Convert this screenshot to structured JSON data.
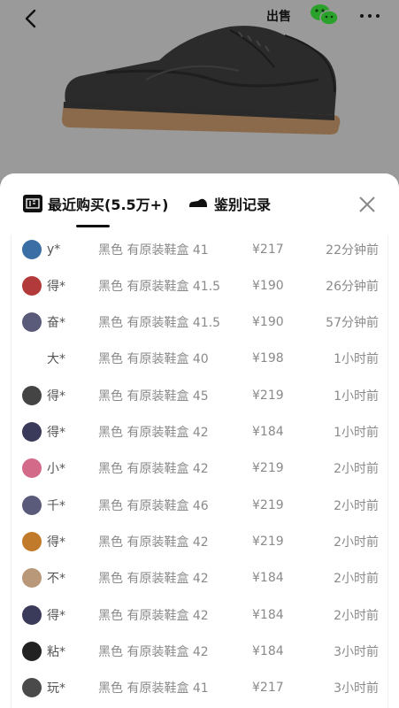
{
  "header": {
    "sell_label": "出售"
  },
  "tabs": {
    "recent": "最近购买(5.5万+)",
    "appraisal": "鉴别记录"
  },
  "colors": {
    "accent": "#111111",
    "wechat": "#2aa12a"
  },
  "records": [
    {
      "user": "y*",
      "desc": "黑色 有原装鞋盒 41",
      "price": "¥217",
      "time": "22分钟前",
      "avatar": "#3a6ea5"
    },
    {
      "user": "得*",
      "desc": "黑色 有原装鞋盒 41.5",
      "price": "¥190",
      "time": "26分钟前",
      "avatar": "#b33a3a"
    },
    {
      "user": "奋*",
      "desc": "黑色 有原装鞋盒 41.5",
      "price": "¥190",
      "time": "57分钟前",
      "avatar": "#5a5a7a"
    },
    {
      "user": "大*",
      "desc": "黑色 有原装鞋盒 40",
      "price": "¥198",
      "time": "1小时前",
      "avatar": "#ffffff"
    },
    {
      "user": "得*",
      "desc": "黑色 有原装鞋盒 45",
      "price": "¥219",
      "time": "1小时前",
      "avatar": "#444444"
    },
    {
      "user": "得*",
      "desc": "黑色 有原装鞋盒 42",
      "price": "¥184",
      "time": "1小时前",
      "avatar": "#3a3a5a"
    },
    {
      "user": "小*",
      "desc": "黑色 有原装鞋盒 42",
      "price": "¥219",
      "time": "2小时前",
      "avatar": "#d46a8a"
    },
    {
      "user": "千*",
      "desc": "黑色 有原装鞋盒 46",
      "price": "¥219",
      "time": "2小时前",
      "avatar": "#5a5a7a"
    },
    {
      "user": "得*",
      "desc": "黑色 有原装鞋盒 42",
      "price": "¥219",
      "time": "2小时前",
      "avatar": "#c07a2a"
    },
    {
      "user": "不*",
      "desc": "黑色 有原装鞋盒 42",
      "price": "¥184",
      "time": "2小时前",
      "avatar": "#b89878"
    },
    {
      "user": "得*",
      "desc": "黑色 有原装鞋盒 42",
      "price": "¥184",
      "time": "2小时前",
      "avatar": "#3a3a5a"
    },
    {
      "user": "粘*",
      "desc": "黑色 有原装鞋盒 42",
      "price": "¥184",
      "time": "3小时前",
      "avatar": "#222222"
    },
    {
      "user": "玩*",
      "desc": "黑色 有原装鞋盒 41",
      "price": "¥217",
      "time": "3小时前",
      "avatar": "#4a4a4a"
    }
  ]
}
